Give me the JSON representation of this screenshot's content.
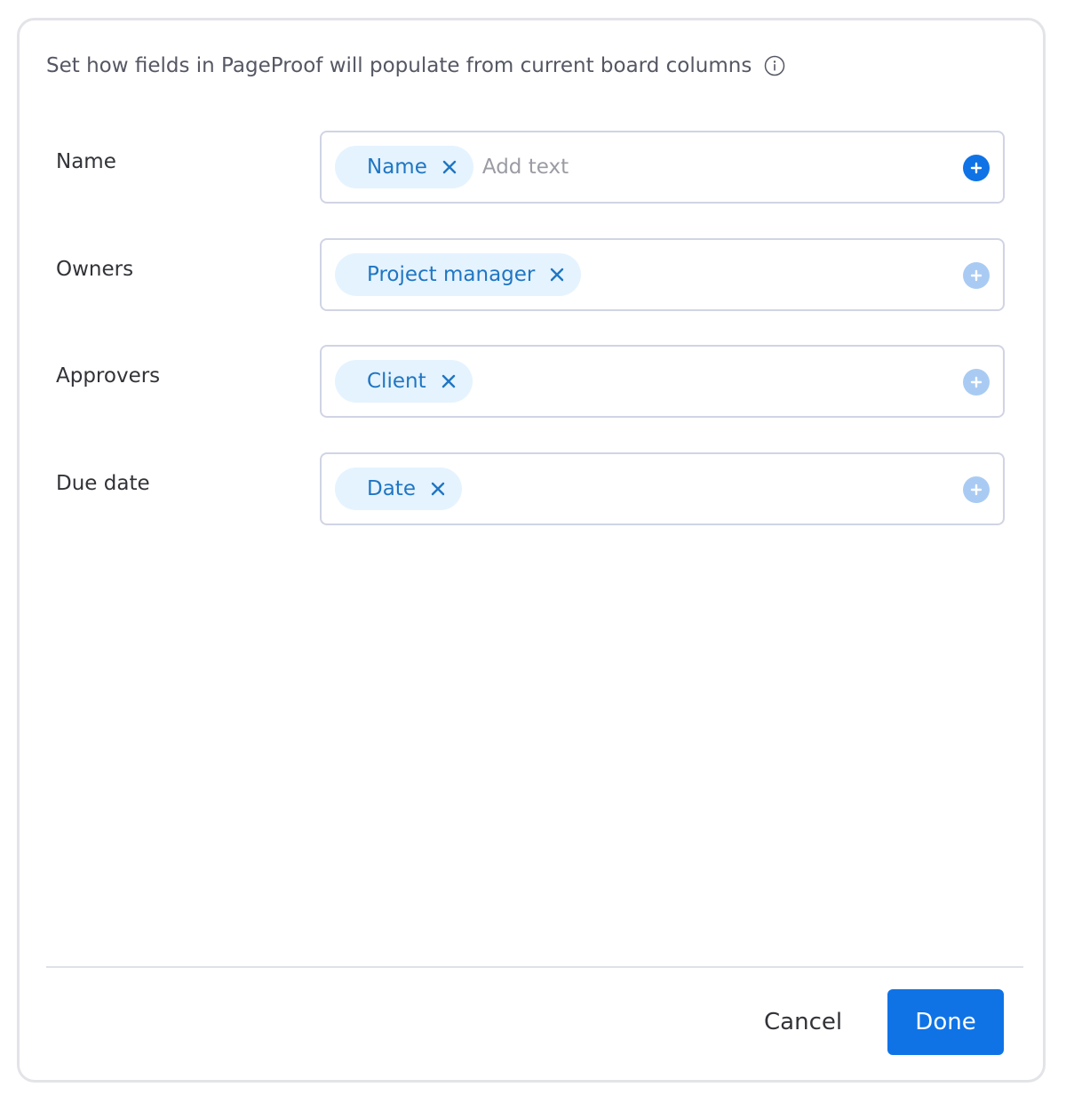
{
  "header": {
    "text": "Set how fields in PageProof will populate from current board columns",
    "info_icon": "info-icon"
  },
  "mappings": [
    {
      "label": "Name",
      "chips": [
        "Name"
      ],
      "input_placeholder": "Add text",
      "add_icon": "plus-icon"
    },
    {
      "label": "Owners",
      "chips": [
        "Project manager"
      ],
      "add_icon": "plus-icon"
    },
    {
      "label": "Approvers",
      "chips": [
        "Client"
      ],
      "add_icon": "plus-icon"
    },
    {
      "label": "Due date",
      "chips": [
        "Date"
      ],
      "add_icon": "plus-icon"
    }
  ],
  "footer": {
    "cancel_label": "Cancel",
    "done_label": "Done"
  },
  "colors": {
    "accent": "#0f73e6",
    "chip_background": "#e5f3ff",
    "chip_text": "#1f76c2",
    "add_inactive": "#a9cbf3"
  }
}
